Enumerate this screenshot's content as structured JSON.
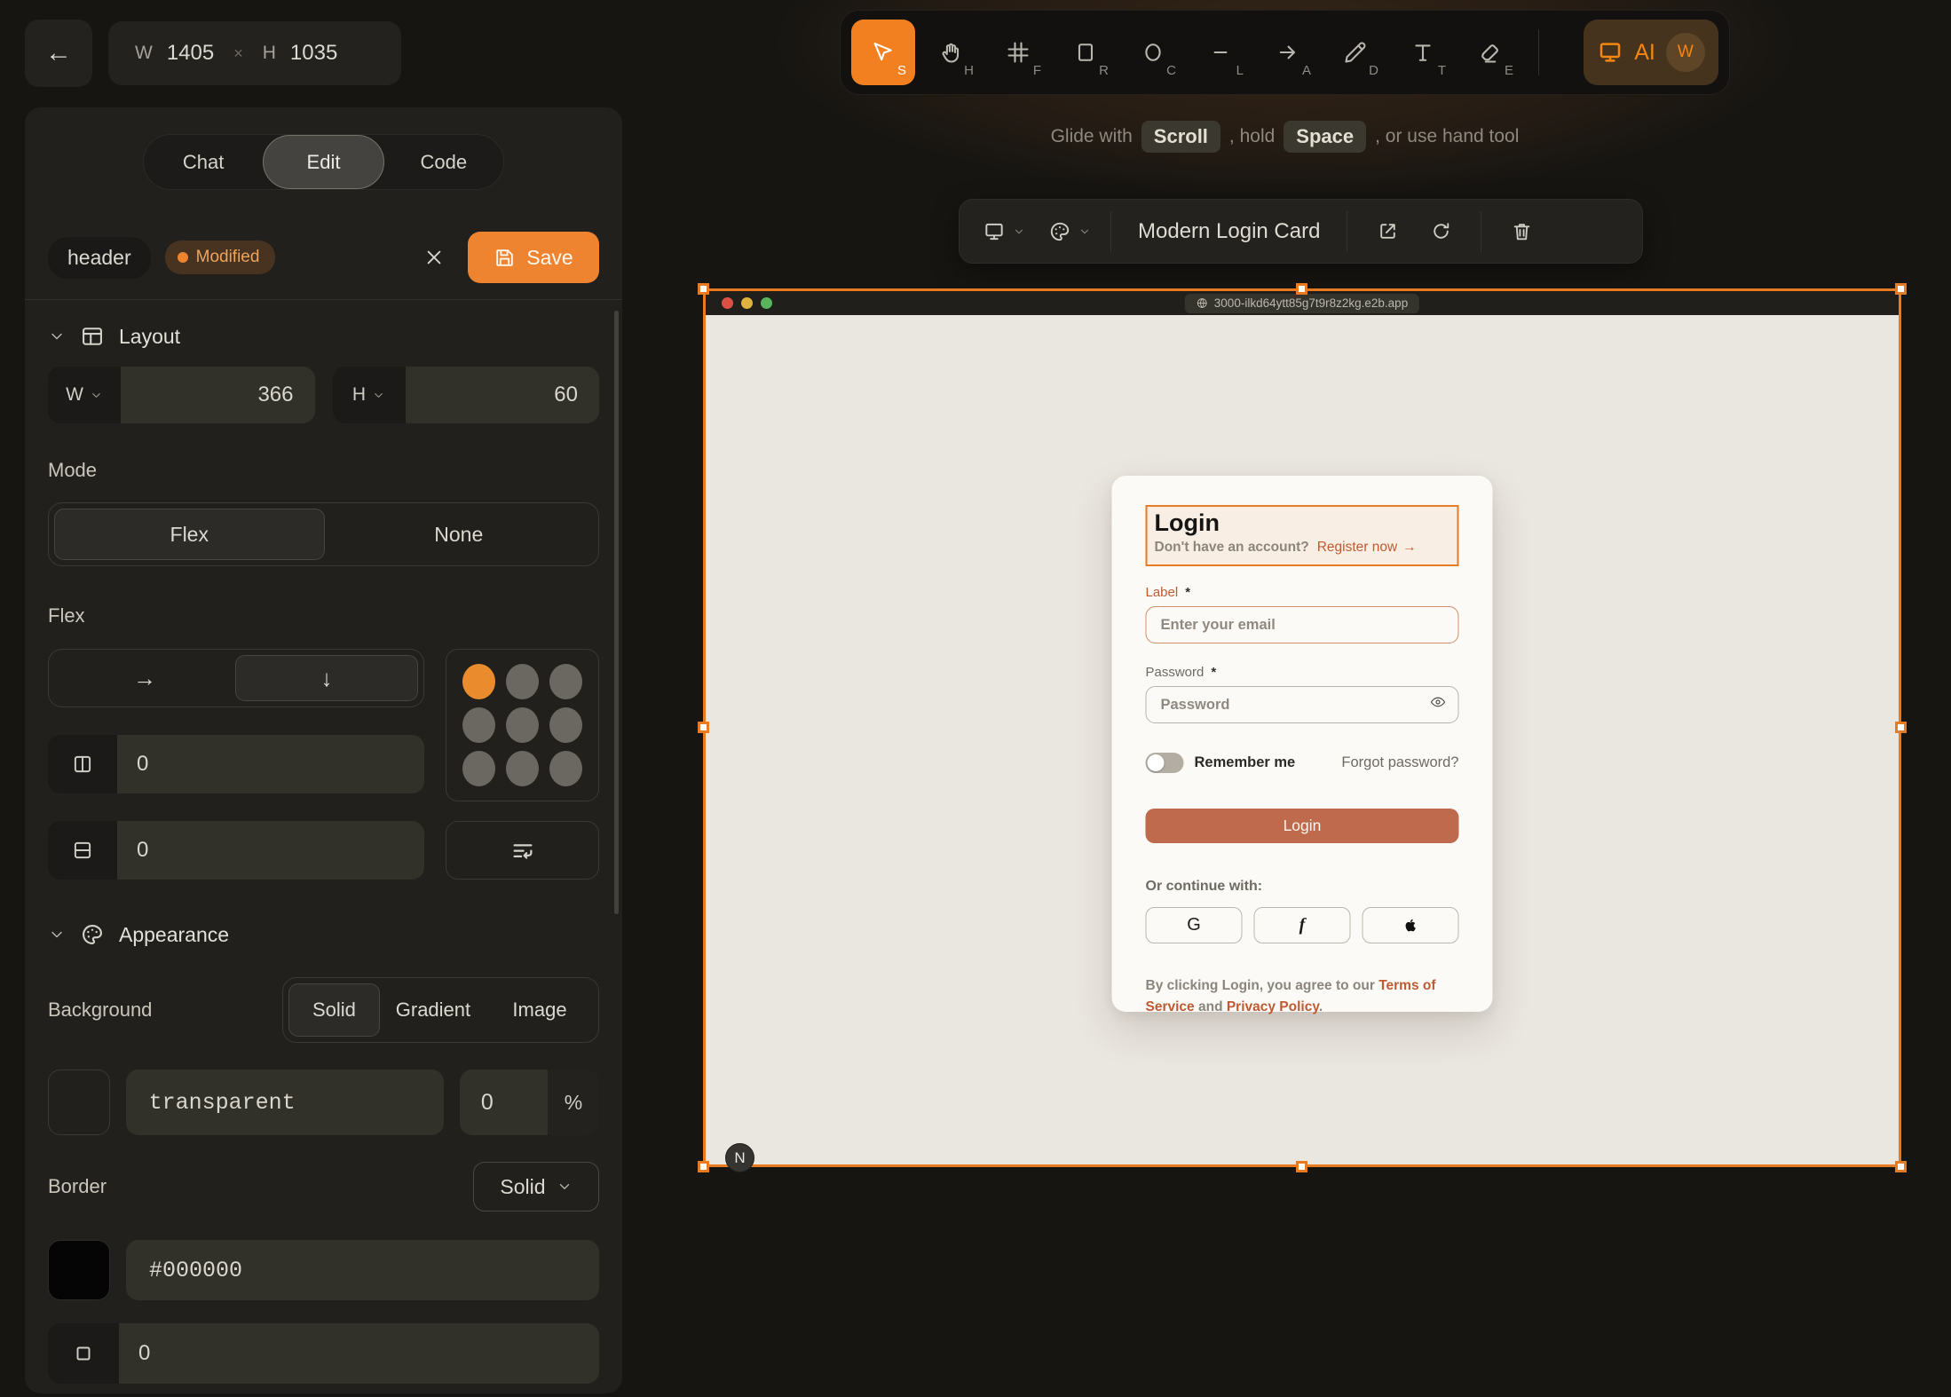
{
  "colors": {
    "accent": "#ee8330",
    "selection": "#e87b22",
    "terracotta": "#bf6a4d",
    "link": "#c05a33"
  },
  "top_left": {
    "w_label": "W",
    "w_value": "1405",
    "times": "×",
    "h_label": "H",
    "h_value": "1035"
  },
  "toolbar": {
    "tools": [
      {
        "name": "select",
        "key": "S"
      },
      {
        "name": "hand",
        "key": "H"
      },
      {
        "name": "frame",
        "key": "F"
      },
      {
        "name": "rectangle",
        "key": "R"
      },
      {
        "name": "ellipse",
        "key": "C"
      },
      {
        "name": "line",
        "key": "L"
      },
      {
        "name": "arrow",
        "key": "A"
      },
      {
        "name": "draw",
        "key": "D"
      },
      {
        "name": "text",
        "key": "T"
      },
      {
        "name": "eraser",
        "key": "E"
      }
    ],
    "ai_label": "AI",
    "ai_key": "W"
  },
  "hint": {
    "pre": "Glide with",
    "key1": "Scroll",
    "mid": ", hold",
    "key2": "Space",
    "post": ", or use hand tool"
  },
  "float_bar": {
    "title": "Modern Login Card"
  },
  "panel": {
    "tabs": {
      "chat": "Chat",
      "edit": "Edit",
      "code": "Code"
    },
    "selection": {
      "tag": "header",
      "badge": "Modified",
      "save": "Save"
    },
    "layout": {
      "title": "Layout",
      "w_label": "W",
      "w_value": "366",
      "h_label": "H",
      "h_value": "60",
      "mode_label": "Mode",
      "mode_flex": "Flex",
      "mode_none": "None",
      "flex_label": "Flex",
      "direction_row": "→",
      "direction_column": "↓",
      "column_gap": "0",
      "row_gap": "0"
    },
    "appearance": {
      "title": "Appearance",
      "background_label": "Background",
      "solid": "Solid",
      "gradient": "Gradient",
      "image": "Image",
      "fill_value": "transparent",
      "opacity_value": "0",
      "opacity_unit": "%",
      "border_label": "Border",
      "border_style": "Solid",
      "border_color": "#000000",
      "border_width": "0"
    }
  },
  "browser": {
    "url": "3000-ilkd64ytt85g7t9r8z2kg.e2b.app"
  },
  "page": {
    "title": "Login",
    "subtitle": "Don't have an account?",
    "register_link": "Register now",
    "register_arrow": "→",
    "email_label": "Label",
    "required_mark": "*",
    "email_placeholder": "Enter your email",
    "password_label": "Password",
    "password_placeholder": "Password",
    "remember": "Remember me",
    "forgot": "Forgot password?",
    "login_button": "Login",
    "continue_label": "Or continue with:",
    "google": "G",
    "facebook": "f",
    "terms_pre": "By clicking Login, you agree to our ",
    "terms_link": "Terms of Service",
    "terms_and": " and ",
    "privacy_link": "Privacy Policy",
    "terms_end": ".",
    "next_badge": "N",
    "back_arrow": "←"
  }
}
